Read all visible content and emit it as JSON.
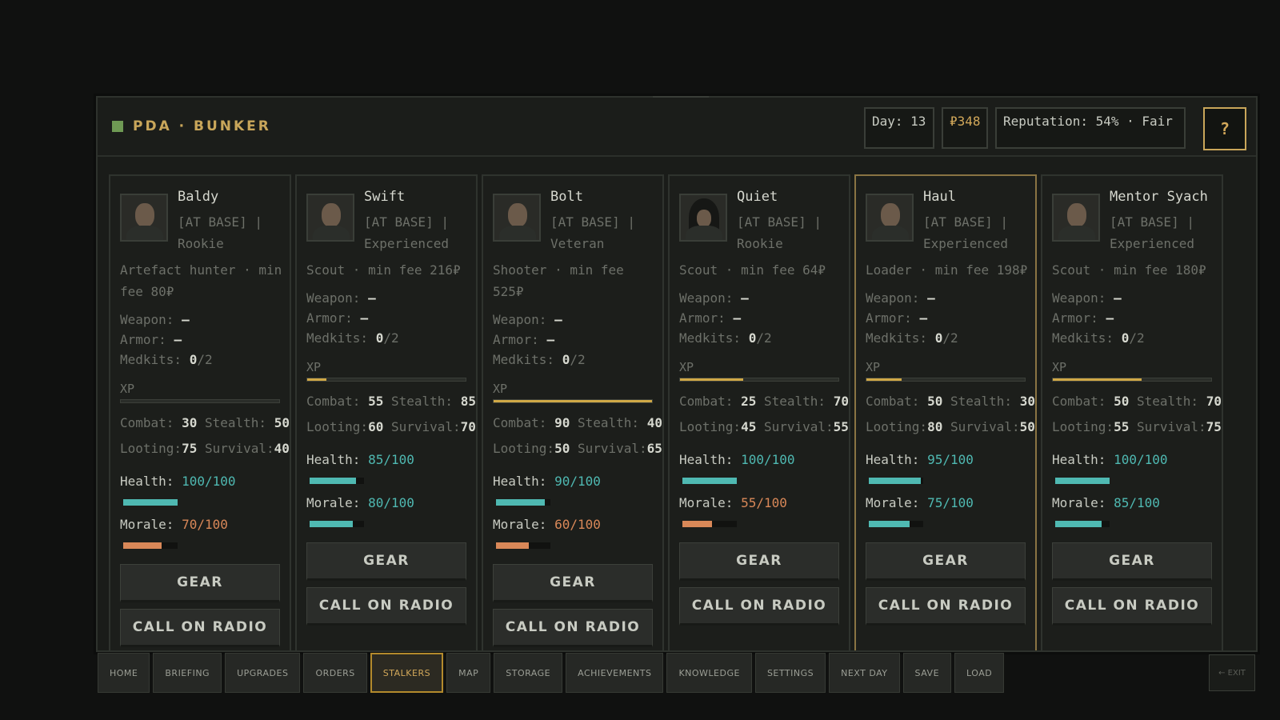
{
  "header": {
    "brand": "PDA · BUNKER",
    "day": "Day: 13",
    "money": "₽348",
    "reputation": "Reputation: 54% · Fair",
    "help": "?"
  },
  "stalkers": [
    {
      "name": "Baldy",
      "status": "[AT BASE] |",
      "rank": "Rookie",
      "role": "Artefact hunter · min fee 80₽",
      "weapon_label": "Weapon:",
      "weapon": "–",
      "armor_label": "Armor:",
      "armor": "–",
      "medkits_label": "Medkits:",
      "medkits": "0",
      "medkits_max": "/2",
      "xp_label": "XP",
      "xp": 0.0,
      "combat_label": "Combat:",
      "combat": "30",
      "stealth_label": "Stealth:",
      "stealth": "50",
      "looting_label": "Looting:",
      "looting": "75",
      "survival_label": "Survival:",
      "survival": "40",
      "health_label": "Health:",
      "health": "100/100",
      "health_value": 100,
      "morale_label": "Morale:",
      "morale": "70/100",
      "morale_value": 70,
      "morale_color": "orange",
      "gear": "GEAR",
      "radio": "CALL ON RADIO",
      "avatar": "bald-portrait"
    },
    {
      "name": "Swift",
      "status": "[AT BASE] |",
      "rank": "Experienced",
      "role": "Scout · min fee 216₽",
      "weapon_label": "Weapon:",
      "weapon": "–",
      "armor_label": "Armor:",
      "armor": "–",
      "medkits_label": "Medkits:",
      "medkits": "0",
      "medkits_max": "/2",
      "xp_label": "XP",
      "xp": 0.12,
      "combat_label": "Combat:",
      "combat": "55",
      "stealth_label": "Stealth:",
      "stealth": "85",
      "looting_label": "Looting:",
      "looting": "60",
      "survival_label": "Survival:",
      "survival": "70",
      "health_label": "Health:",
      "health": "85/100",
      "health_value": 85,
      "morale_label": "Morale:",
      "morale": "80/100",
      "morale_value": 80,
      "morale_color": "teal",
      "gear": "GEAR",
      "radio": "CALL ON RADIO",
      "avatar": "dark-portrait"
    },
    {
      "name": "Bolt",
      "status": "[AT BASE] |",
      "rank": "Veteran",
      "role": "Shooter · min fee 525₽",
      "weapon_label": "Weapon:",
      "weapon": "–",
      "armor_label": "Armor:",
      "armor": "–",
      "medkits_label": "Medkits:",
      "medkits": "0",
      "medkits_max": "/2",
      "xp_label": "XP",
      "xp": 1.0,
      "combat_label": "Combat:",
      "combat": "90",
      "stealth_label": "Stealth:",
      "stealth": "40",
      "looting_label": "Looting:",
      "looting": "50",
      "survival_label": "Survival:",
      "survival": "65",
      "health_label": "Health:",
      "health": "90/100",
      "health_value": 90,
      "morale_label": "Morale:",
      "morale": "60/100",
      "morale_value": 60,
      "morale_color": "orange",
      "gear": "GEAR",
      "radio": "CALL ON RADIO",
      "avatar": "veteran-portrait"
    },
    {
      "name": "Quiet",
      "status": "[AT BASE] |",
      "rank": "Rookie",
      "role": "Scout · min fee 64₽",
      "weapon_label": "Weapon:",
      "weapon": "–",
      "armor_label": "Armor:",
      "armor": "–",
      "medkits_label": "Medkits:",
      "medkits": "0",
      "medkits_max": "/2",
      "xp_label": "XP",
      "xp": 0.4,
      "combat_label": "Combat:",
      "combat": "25",
      "stealth_label": "Stealth:",
      "stealth": "70",
      "looting_label": "Looting:",
      "looting": "45",
      "survival_label": "Survival:",
      "survival": "55",
      "health_label": "Health:",
      "health": "100/100",
      "health_value": 100,
      "morale_label": "Morale:",
      "morale": "55/100",
      "morale_value": 55,
      "morale_color": "orange",
      "gear": "GEAR",
      "radio": "CALL ON RADIO",
      "avatar": "hooded-portrait"
    },
    {
      "name": "Haul",
      "status": "[AT BASE] |",
      "rank": "Experienced",
      "role": "Loader · min fee 198₽",
      "weapon_label": "Weapon:",
      "weapon": "–",
      "armor_label": "Armor:",
      "armor": "–",
      "medkits_label": "Medkits:",
      "medkits": "0",
      "medkits_max": "/2",
      "xp_label": "XP",
      "xp": 0.22,
      "combat_label": "Combat:",
      "combat": "50",
      "stealth_label": "Stealth:",
      "stealth": "30",
      "looting_label": "Looting:",
      "looting": "80",
      "survival_label": "Survival:",
      "survival": "50",
      "health_label": "Health:",
      "health": "95/100",
      "health_value": 95,
      "morale_label": "Morale:",
      "morale": "75/100",
      "morale_value": 75,
      "morale_color": "teal",
      "gear": "GEAR",
      "radio": "CALL ON RADIO",
      "avatar": "bearded-portrait"
    },
    {
      "name": "Mentor Syach",
      "status": "[AT BASE] |",
      "rank": "Experienced",
      "role": "Scout · min fee 180₽",
      "weapon_label": "Weapon:",
      "weapon": "–",
      "armor_label": "Armor:",
      "armor": "–",
      "medkits_label": "Medkits:",
      "medkits": "0",
      "medkits_max": "/2",
      "xp_label": "XP",
      "xp": 0.56,
      "combat_label": "Combat:",
      "combat": "50",
      "stealth_label": "Stealth:",
      "stealth": "70",
      "looting_label": "Looting:",
      "looting": "55",
      "survival_label": "Survival:",
      "survival": "75",
      "health_label": "Health:",
      "health": "100/100",
      "health_value": 100,
      "morale_label": "Morale:",
      "morale": "85/100",
      "morale_value": 85,
      "morale_color": "teal",
      "gear": "GEAR",
      "radio": "CALL ON RADIO",
      "avatar": "mentor-portrait"
    }
  ],
  "selected_stalker": "Haul",
  "nav": [
    "HOME",
    "BRIEFING",
    "UPGRADES",
    "ORDERS",
    "STALKERS",
    "MAP",
    "STORAGE",
    "ACHIEVEMENTS",
    "KNOWLEDGE",
    "SETTINGS",
    "NEXT DAY",
    "SAVE",
    "LOAD"
  ],
  "nav_active": "STALKERS",
  "exit": "← EXIT",
  "colors": {
    "accent": "#c9a65a",
    "teal": "#4fb9b2",
    "orange": "#d98858",
    "xp": "#d0a846"
  }
}
